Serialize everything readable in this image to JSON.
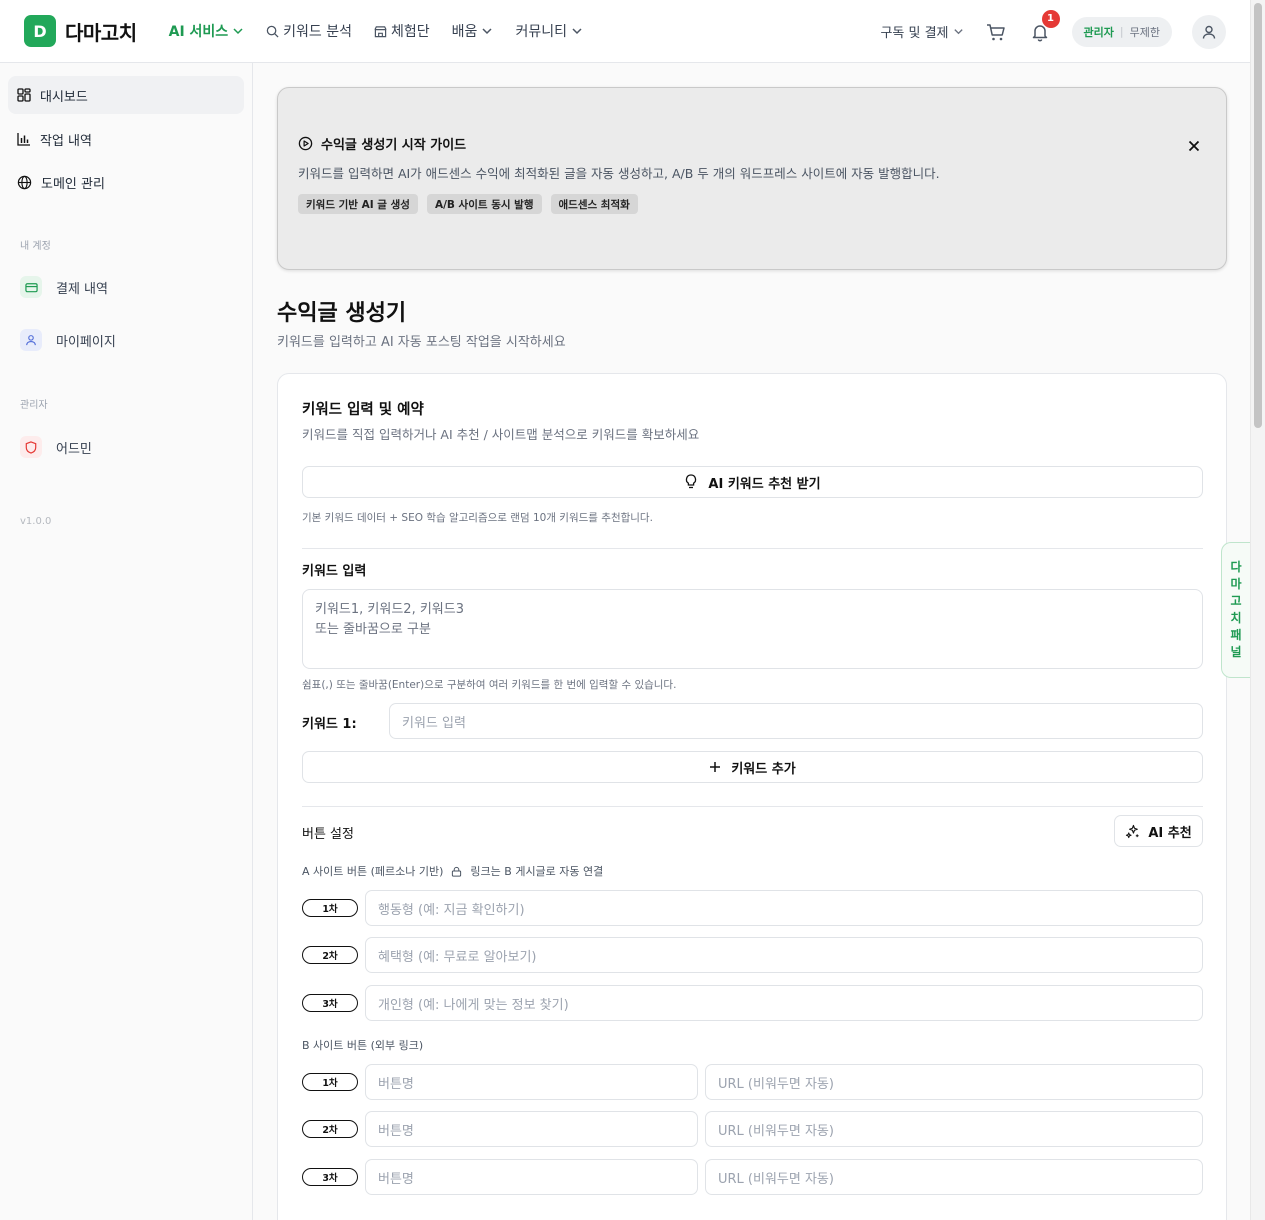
{
  "header": {
    "logo_letter": "D",
    "logo_text": "다마고치",
    "nav": [
      {
        "label": "AI 서비스",
        "icon": "chevron-down-icon"
      },
      {
        "label": "키워드 분석",
        "icon": "search-icon"
      },
      {
        "label": "체험단",
        "icon": "store-icon"
      },
      {
        "label": "배움",
        "icon": "chevron-down-icon"
      },
      {
        "label": "커뮤니티",
        "icon": "chevron-down-icon"
      }
    ],
    "subscription_label": "구독 및 결제",
    "notification_count": "1",
    "role_label": "관리자",
    "plan_label": "무제한"
  },
  "sidebar": {
    "items": [
      {
        "label": "대시보드",
        "icon": "dashboard-icon"
      },
      {
        "label": "작업 내역",
        "icon": "bar-chart-icon"
      },
      {
        "label": "도메인 관리",
        "icon": "globe-icon"
      }
    ],
    "account_section": "내 계정",
    "account_items": [
      {
        "label": "결제 내역",
        "icon": "card-icon"
      },
      {
        "label": "마이페이지",
        "icon": "user-icon"
      }
    ],
    "admin_section": "관리자",
    "admin_items": [
      {
        "label": "어드민",
        "icon": "shield-icon"
      }
    ],
    "version": "v1.0.0"
  },
  "guide": {
    "title": "수익글 생성기 시작 가이드",
    "description": "키워드를 입력하면 AI가 애드센스 수익에 최적화된 글을 자동 생성하고, A/B 두 개의 워드프레스 사이트에 자동 발행합니다.",
    "chips": [
      "키워드 기반 AI 글 생성",
      "A/B 사이트 동시 발행",
      "애드센스 최적화"
    ]
  },
  "page": {
    "title": "수익글 생성기",
    "subtitle": "키워드를 입력하고 AI 자동 포스팅 작업을 시작하세요"
  },
  "keyword_card": {
    "title": "키워드 입력 및 예약",
    "subtitle": "키워드를 직접 입력하거나 AI 추천 / 사이트맵 분석으로 키워드를 확보하세요",
    "ai_recommend_button": "AI 키워드 추천 받기",
    "ai_recommend_hint": "기본 키워드 데이터 + SEO 학습 알고리즘으로 랜덤 10개 키워드를 추천합니다.",
    "keyword_input_label": "키워드 입력",
    "keyword_textarea_placeholder": "키워드1, 키워드2, 키워드3\n또는 줄바꿈으로 구분",
    "keyword_input_hint": "쉼표(,) 또는 줄바꿈(Enter)으로 구분하여 여러 키워드를 한 번에 입력할 수 있습니다.",
    "keyword_1_label": "키워드 1:",
    "keyword_1_placeholder": "키워드 입력",
    "add_keyword_button": "키워드 추가"
  },
  "button_settings": {
    "title": "버튼 설정",
    "ai_button": "AI 추천",
    "a_site_label": "A 사이트 버튼 (페르소나 기반)",
    "a_site_lock_note": "링크는 B 게시글로 자동 연결",
    "a_buttons": [
      {
        "tag": "1차",
        "placeholder": "행동형 (예: 지금 확인하기)"
      },
      {
        "tag": "2차",
        "placeholder": "혜택형 (예: 무료로 알아보기)"
      },
      {
        "tag": "3차",
        "placeholder": "개인형 (예: 나에게 맞는 정보 찾기)"
      }
    ],
    "b_site_label": "B 사이트 버튼 (외부 링크)",
    "b_buttons": [
      {
        "tag": "1차",
        "name_placeholder": "버튼명",
        "url_placeholder": "URL (비워두면 자동)"
      },
      {
        "tag": "2차",
        "name_placeholder": "버튼명",
        "url_placeholder": "URL (비워두면 자동)"
      },
      {
        "tag": "3차",
        "name_placeholder": "버튼명",
        "url_placeholder": "URL (비워두면 자동)"
      }
    ]
  },
  "side_panel": {
    "label": [
      "다",
      "마",
      "고",
      "치",
      "패",
      "널"
    ]
  },
  "colors": {
    "brand": "#22a85a",
    "badge": "#e53935"
  }
}
